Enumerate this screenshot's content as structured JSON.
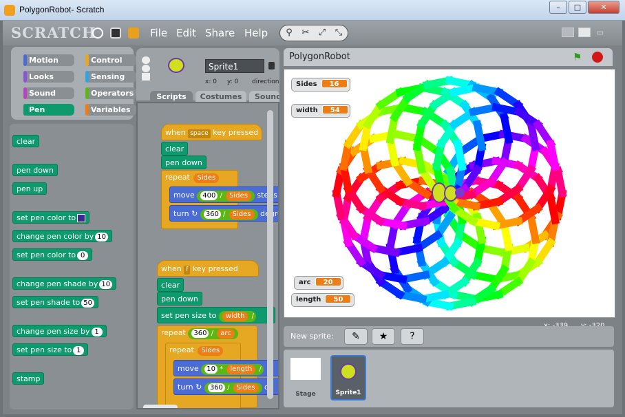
{
  "window": {
    "title": "PolygonRobot- Scratch",
    "min": "–",
    "max": "□",
    "close": "✕"
  },
  "menu": {
    "logo": "SCRATCH",
    "items": [
      "File",
      "Edit",
      "Share",
      "Help"
    ]
  },
  "categories": [
    "Motion",
    "Control",
    "Looks",
    "Sensing",
    "Sound",
    "Operators",
    "Pen",
    "Variables"
  ],
  "palette": {
    "clear": "clear",
    "pen_down": "pen down",
    "pen_up": "pen up",
    "set_pen_color_to": "set pen color to",
    "change_pen_color_by": "change pen color by",
    "change_pen_color_val": "10",
    "set_pen_color_to_num": "set pen color to",
    "set_pen_color_num_val": "0",
    "change_pen_shade_by": "change pen shade by",
    "change_pen_shade_val": "10",
    "set_pen_shade_to": "set pen shade to",
    "set_pen_shade_val": "50",
    "change_pen_size_by": "change pen size by",
    "change_pen_size_val": "1",
    "set_pen_size_to": "set pen size to",
    "set_pen_size_val": "1",
    "stamp": "stamp"
  },
  "sprite": {
    "name": "Sprite1",
    "x": "x: 0",
    "y": "y: 0",
    "dir": "direction",
    "tabs": [
      "Scripts",
      "Costumes",
      "Sounds"
    ]
  },
  "scripts": {
    "s1": {
      "when": "when",
      "key": "space",
      "key_pressed": "key pressed",
      "clear": "clear",
      "pen_down": "pen down",
      "repeat": "repeat",
      "sides": "Sides",
      "move": "move",
      "n400": "400",
      "slash": "/",
      "steps": "steps",
      "turn": "turn",
      "n360": "360",
      "degrees": "degrees"
    },
    "s2": {
      "when": "when",
      "key": "f",
      "key_pressed": "key pressed",
      "clear": "clear",
      "pen_down": "pen down",
      "set_pen_size": "set pen size to",
      "width": "width",
      "slash": "/",
      "repeat": "repeat",
      "n360": "360",
      "arc": "arc",
      "sides": "Sides",
      "move": "move",
      "n10": "10",
      "times": "*",
      "length": "length",
      "turn": "turn",
      "d": "d"
    }
  },
  "stage": {
    "title": "PolygonRobot",
    "watchers": [
      {
        "label": "Sides",
        "value": "16"
      },
      {
        "label": "width",
        "value": "54"
      },
      {
        "label": "arc",
        "value": "20"
      },
      {
        "label": "length",
        "value": "50"
      }
    ],
    "mouse_x": "x: -339",
    "mouse_y": "y: -320"
  },
  "sprites": {
    "new_sprite_label": "New sprite:",
    "stage_label": "Stage",
    "sprite1_label": "Sprite1"
  },
  "colors": {
    "pen": "#0e9a6c",
    "control": "#e6a822",
    "motion": "#4a6cd4",
    "variables": "#ee7d16",
    "operators": "#5cb712"
  }
}
